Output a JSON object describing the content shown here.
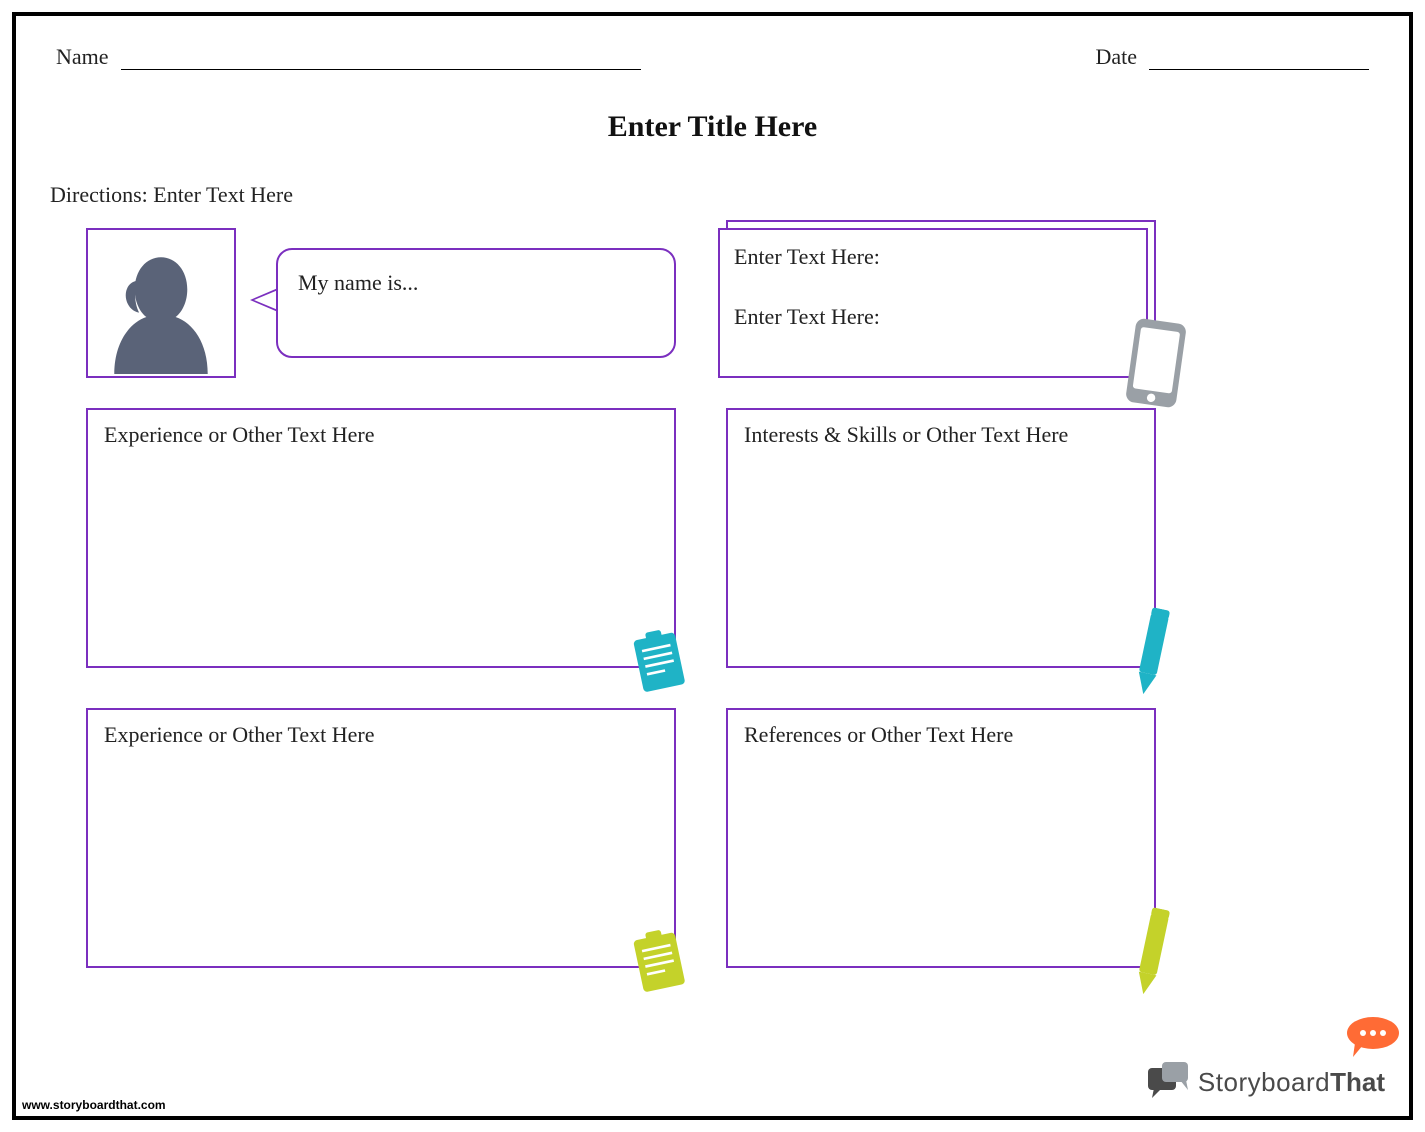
{
  "header": {
    "name_label": "Name",
    "date_label": "Date"
  },
  "title": "Enter Title Here",
  "directions": "Directions: Enter Text Here",
  "speech": "My name is...",
  "contact": {
    "line1": "Enter Text Here:",
    "line2": "Enter Text Here:"
  },
  "sections": {
    "experience1": "Experience or Other Text Here",
    "interests": "Interests & Skills or Other Text Here",
    "experience2": "Experience or Other Text Here",
    "references": "References or Other Text Here"
  },
  "footer": {
    "url": "www.storyboardthat.com",
    "brand1": "Storyboard",
    "brand2": "That"
  },
  "colors": {
    "border": "#7b2fbf",
    "avatar": "#5a6378",
    "teal": "#1fb3c6",
    "lime": "#c4d22a",
    "orange": "#ff6b35",
    "grey": "#9aa0a6"
  }
}
